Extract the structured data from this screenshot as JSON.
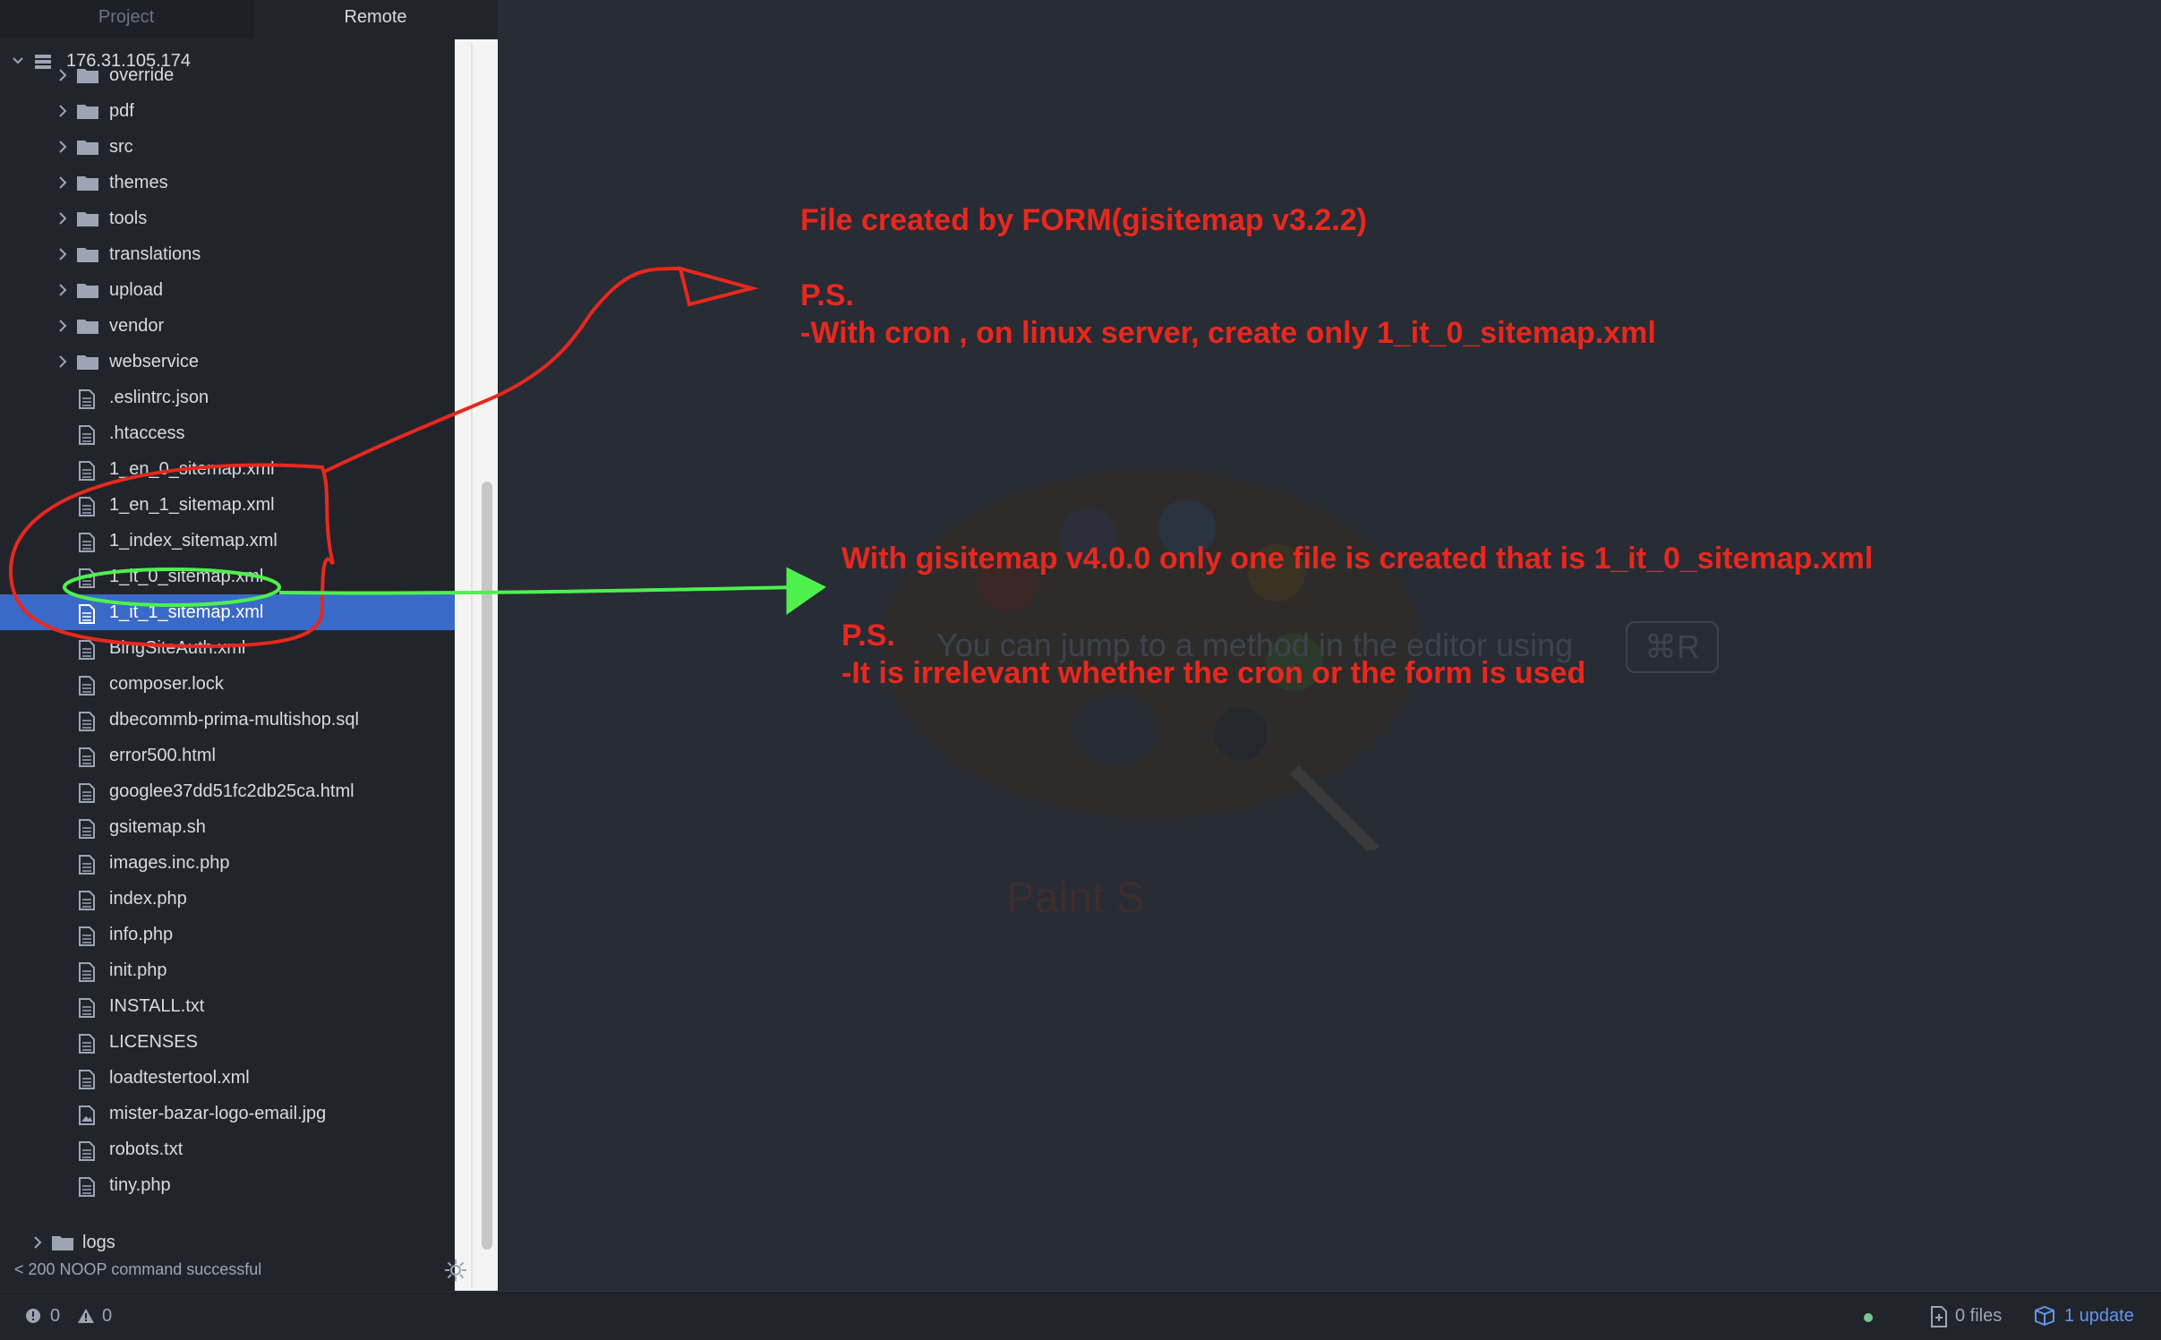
{
  "tabs": [
    {
      "label": "Project"
    },
    {
      "label": "Remote"
    }
  ],
  "tree": {
    "server": "176.31.105.174",
    "items": [
      {
        "label": "override",
        "kind": "folder"
      },
      {
        "label": "pdf",
        "kind": "folder"
      },
      {
        "label": "src",
        "kind": "folder"
      },
      {
        "label": "themes",
        "kind": "folder"
      },
      {
        "label": "tools",
        "kind": "folder"
      },
      {
        "label": "translations",
        "kind": "folder"
      },
      {
        "label": "upload",
        "kind": "folder"
      },
      {
        "label": "vendor",
        "kind": "folder"
      },
      {
        "label": "webservice",
        "kind": "folder"
      },
      {
        "label": ".eslintrc.json",
        "kind": "file"
      },
      {
        "label": ".htaccess",
        "kind": "file"
      },
      {
        "label": "1_en_0_sitemap.xml",
        "kind": "file"
      },
      {
        "label": "1_en_1_sitemap.xml",
        "kind": "file"
      },
      {
        "label": "1_index_sitemap.xml",
        "kind": "file"
      },
      {
        "label": "1_it_0_sitemap.xml",
        "kind": "file"
      },
      {
        "label": "1_it_1_sitemap.xml",
        "kind": "file",
        "selected": true
      },
      {
        "label": "BingSiteAuth.xml",
        "kind": "file"
      },
      {
        "label": "composer.lock",
        "kind": "file"
      },
      {
        "label": "dbecommb-prima-multishop.sql",
        "kind": "file"
      },
      {
        "label": "error500.html",
        "kind": "file"
      },
      {
        "label": "googlee37dd51fc2db25ca.html",
        "kind": "file"
      },
      {
        "label": "gsitemap.sh",
        "kind": "file"
      },
      {
        "label": "images.inc.php",
        "kind": "file"
      },
      {
        "label": "index.php",
        "kind": "file"
      },
      {
        "label": "info.php",
        "kind": "file"
      },
      {
        "label": "init.php",
        "kind": "file"
      },
      {
        "label": "INSTALL.txt",
        "kind": "file"
      },
      {
        "label": "LICENSES",
        "kind": "file"
      },
      {
        "label": "loadtestertool.xml",
        "kind": "file"
      },
      {
        "label": "mister-bazar-logo-email.jpg",
        "kind": "image"
      },
      {
        "label": "robots.txt",
        "kind": "file"
      },
      {
        "label": "tiny.php",
        "kind": "file"
      }
    ],
    "logs": "logs"
  },
  "status_message": "< 200 NOOP command successful",
  "statusbar": {
    "errors": "0",
    "warnings": "0",
    "files": "0 files",
    "updates": "1 update"
  },
  "editor": {
    "hint": "You can jump to a method in the editor using",
    "shortcut": "⌘R",
    "caption": "Paint S"
  },
  "annotations": {
    "line1": "File created by FORM(gisitemap v3.2.2)",
    "line2": "P.S.",
    "line3": "-With cron , on linux server, create only 1_it_0_sitemap.xml",
    "line4": "With gisitemap v4.0.0  only one file is created that is 1_it_0_sitemap.xml",
    "line5": "P.S.",
    "line6": "-It is irrelevant whether the cron or the form is used"
  },
  "colors": {
    "selection": "#3a6ac8",
    "annotation_red": "#e8281e",
    "annotation_green": "#4ef04e"
  }
}
